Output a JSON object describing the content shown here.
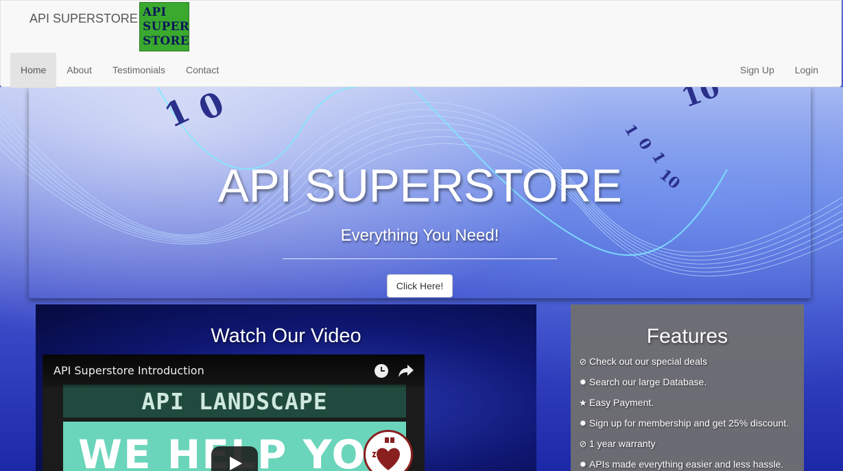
{
  "navbar": {
    "brand": "API SUPERSTORE",
    "logo_lines": [
      "API",
      "SUPER",
      "STORE"
    ],
    "left_items": [
      "Home",
      "About",
      "Testimonials",
      "Contact"
    ],
    "active_item": "Home",
    "right_items": [
      "Sign Up",
      "Login"
    ]
  },
  "hero": {
    "title": "API SUPERSTORE",
    "subtitle": "Everything You Need!",
    "button_label": "Click Here!"
  },
  "video": {
    "heading": "Watch Our Video",
    "title": "API Superstore Introduction",
    "thumb_top_text": "API LANDSCAPE",
    "thumb_bottom_text": "WE HELP YOU"
  },
  "features": {
    "heading": "Features",
    "items": [
      {
        "icon": "check-circle-icon",
        "glyph": "⊘",
        "text": "Check out our special deals"
      },
      {
        "icon": "starburst-icon",
        "glyph": "✹",
        "text": "Search our large Database."
      },
      {
        "icon": "star-icon",
        "glyph": "★",
        "text": "Easy Payment."
      },
      {
        "icon": "starburst-icon",
        "glyph": "✹",
        "text": "Sign up for membership and get 25% discount."
      },
      {
        "icon": "check-circle-icon",
        "glyph": "⊘",
        "text": "1 year warranty"
      },
      {
        "icon": "starburst-icon",
        "glyph": "✹",
        "text": "APIs made everything easier and less hassle."
      }
    ]
  },
  "colors": {
    "logo_green": "#3aa92e",
    "navbar_bg": "#f8f8f8",
    "features_bg": "#707070"
  }
}
